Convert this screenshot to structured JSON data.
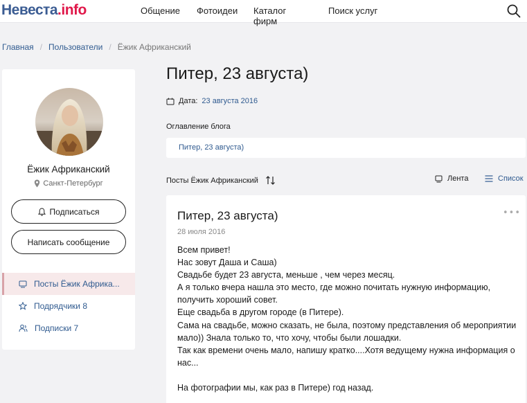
{
  "header": {
    "logo_part1": "Невеста",
    "logo_part2": ".info",
    "nav": [
      "Общение",
      "Фотоидеи",
      "Каталог фирм",
      "Поиск услуг"
    ]
  },
  "breadcrumb": {
    "home": "Главная",
    "users": "Пользователи",
    "current": "Ёжик Африканский"
  },
  "profile": {
    "name": "Ёжик Африканский",
    "city": "Санкт-Петербург",
    "subscribe_label": "Подписаться",
    "message_label": "Написать сообщение",
    "menu": [
      {
        "label": "Посты Ёжик Африка..."
      },
      {
        "label": "Подрядчики 8"
      },
      {
        "label": "Подписки 7"
      }
    ]
  },
  "page": {
    "title": "Питер, 23 августа)",
    "date_label": "Дата:",
    "date_value": "23 августа 2016",
    "toc_heading": "Оглавление блога",
    "toc_item": "Питер, 23 августа)",
    "posts_heading": "Посты Ёжик Африканский",
    "view_feed": "Лента",
    "view_list": "Список"
  },
  "post": {
    "title": "Питер, 23 августа)",
    "date": "28 июля 2016",
    "lines": [
      "Всем привет!",
      "Нас зовут Даша и Саша)",
      "Свадьбе будет 23 августа, меньше , чем через месяц.",
      "А я только вчера нашла это место, где можно почитать нужную информацию, получить хороший совет.",
      "Еще свадьба в другом городе (в Питере).",
      "Сама на свадьбе, можно сказать, не была, поэтому представления об мероприятии мало)) Знала только то, что хочу, чтобы были лошадки.",
      "Так как времени очень мало, напишу кратко....Хотя ведущему нужна информация о нас...",
      "",
      "На фотографии мы, как раз в Питере) год назад."
    ]
  },
  "colors": {
    "link": "#2f5a8f",
    "logo_blue": "#3b5c93",
    "logo_red": "#e0184a",
    "active_bg": "#f7e9ea"
  }
}
